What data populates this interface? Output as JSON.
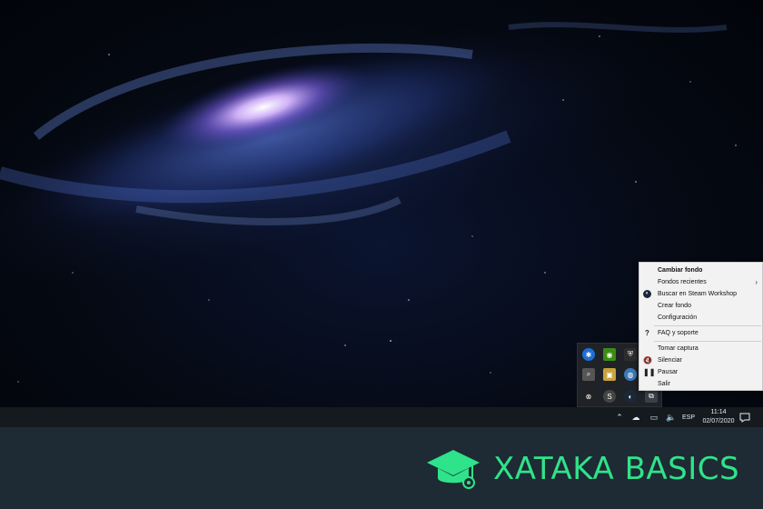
{
  "context_menu": {
    "items": [
      {
        "label": "Cambiar fondo",
        "bold": true,
        "icon": ""
      },
      {
        "label": "Fondos recientes",
        "submenu": true,
        "icon": ""
      },
      {
        "label": "Buscar en Steam Workshop",
        "icon": "steam-icon"
      },
      {
        "label": "Crear fondo",
        "icon": ""
      },
      {
        "label": "Configuración",
        "icon": ""
      },
      {
        "label": "FAQ y soporte",
        "icon": "question-icon"
      },
      {
        "label": "Tomar captura",
        "icon": ""
      },
      {
        "label": "Silenciar",
        "icon": "mute-icon"
      },
      {
        "label": "Pausar",
        "icon": "pause-icon"
      },
      {
        "label": "Salir",
        "icon": ""
      }
    ]
  },
  "taskbar": {
    "language": "ESP",
    "time": "11:14",
    "date": "02/07/2020"
  },
  "brand": {
    "text": "XATAKA BASICS",
    "color": "#2fe38a"
  }
}
